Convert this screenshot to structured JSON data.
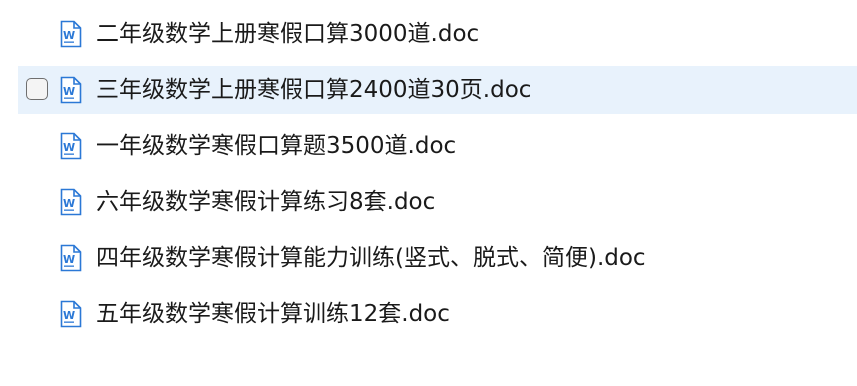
{
  "colors": {
    "hover_background": "#e8f2fc",
    "word_icon_blue": "#2b78d6",
    "text": "#1a1a1a"
  },
  "icons": {
    "file_type_icon": "word-document-icon",
    "icon_letter": "W"
  },
  "files": [
    {
      "name": "二年级数学上册寒假口算3000道.doc",
      "hovered": false,
      "checkbox_visible": false,
      "checked": false
    },
    {
      "name": "三年级数学上册寒假口算2400道30页.doc",
      "hovered": true,
      "checkbox_visible": true,
      "checked": false
    },
    {
      "name": "一年级数学寒假口算题3500道.doc",
      "hovered": false,
      "checkbox_visible": false,
      "checked": false
    },
    {
      "name": "六年级数学寒假计算练习8套.doc",
      "hovered": false,
      "checkbox_visible": false,
      "checked": false
    },
    {
      "name": "四年级数学寒假计算能力训练(竖式、脱式、简便).doc",
      "hovered": false,
      "checkbox_visible": false,
      "checked": false
    },
    {
      "name": "五年级数学寒假计算训练12套.doc",
      "hovered": false,
      "checkbox_visible": false,
      "checked": false
    }
  ]
}
